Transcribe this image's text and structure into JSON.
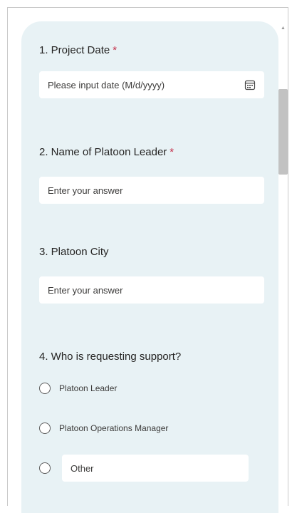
{
  "form": {
    "q1": {
      "title": "1. Project Date",
      "required_mark": "*",
      "placeholder": "Please input date (M/d/yyyy)"
    },
    "q2": {
      "title": "2. Name of Platoon Leader",
      "required_mark": "*",
      "placeholder": "Enter your answer"
    },
    "q3": {
      "title": "3. Platoon City",
      "placeholder": "Enter your answer"
    },
    "q4": {
      "title": "4. Who is requesting support?",
      "options": [
        "Platoon Leader",
        "Platoon Operations Manager"
      ],
      "other_placeholder": "Other"
    }
  },
  "icons": {
    "date_picker": "calendar-icon",
    "scroll_up": "scroll-up-arrow-icon"
  },
  "colors": {
    "card_background": "#e8f2f5",
    "required_star": "#c4314b",
    "scrollbar_thumb": "#c2c2c2"
  }
}
